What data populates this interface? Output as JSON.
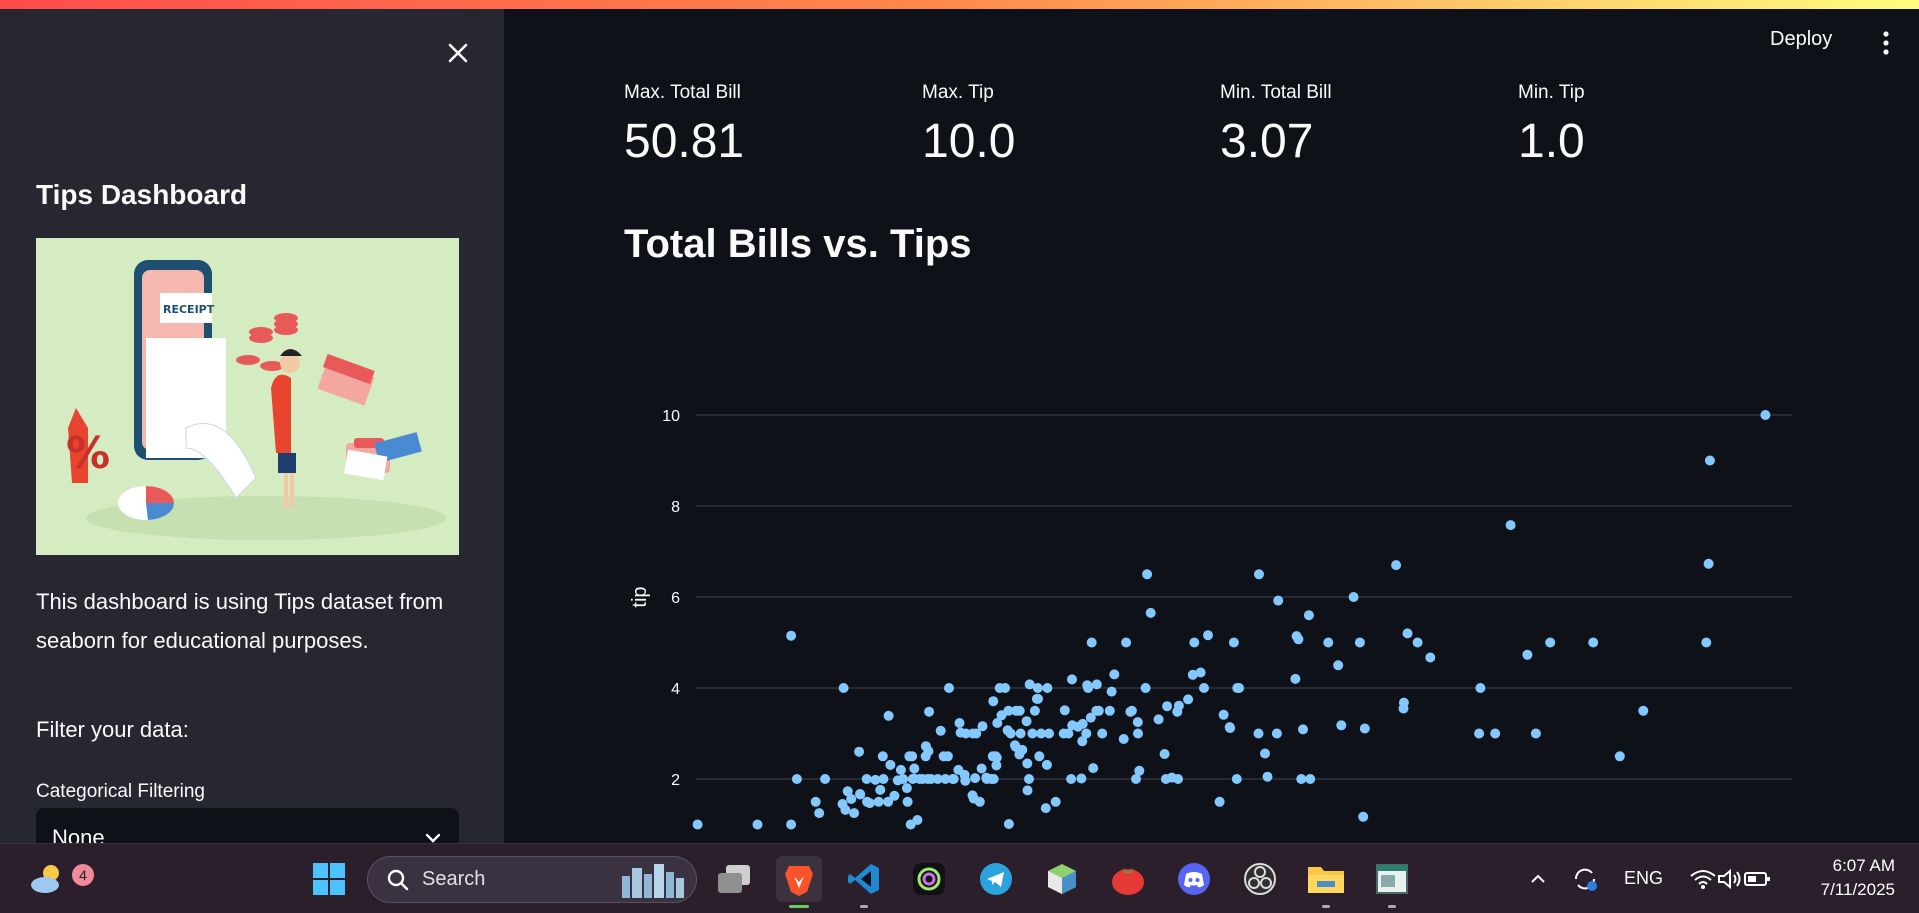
{
  "header": {
    "deploy_label": "Deploy"
  },
  "sidebar": {
    "title": "Tips Dashboard",
    "description": "This dashboard is using Tips dataset from seaborn for educational purposes.",
    "filter_heading": "Filter your data:",
    "categorical_label": "Categorical Filtering",
    "categorical_value": "None",
    "image_text": "RECEIPT"
  },
  "metrics": [
    {
      "label": "Max. Total Bill",
      "value": "50.81"
    },
    {
      "label": "Max. Tip",
      "value": "10.0"
    },
    {
      "label": "Min. Total Bill",
      "value": "3.07"
    },
    {
      "label": "Min. Tip",
      "value": "1.0"
    }
  ],
  "main": {
    "chart_title": "Total Bills vs. Tips"
  },
  "chart_data": {
    "type": "scatter",
    "title": "Total Bills vs. Tips",
    "xlabel": "",
    "ylabel": "tip",
    "ylim": [
      0.5,
      10.5
    ],
    "xlim": [
      3,
      52
    ],
    "yticks": [
      2,
      4,
      6,
      8,
      10
    ],
    "grid": true,
    "color": "#83c9ff",
    "points": [
      [
        3.07,
        1.0
      ],
      [
        5.75,
        1.0
      ],
      [
        7.25,
        1.0
      ],
      [
        7.25,
        5.15
      ],
      [
        7.51,
        2.0
      ],
      [
        8.35,
        1.5
      ],
      [
        8.51,
        1.25
      ],
      [
        8.77,
        2.0
      ],
      [
        9.55,
        1.45
      ],
      [
        9.6,
        4.0
      ],
      [
        9.68,
        1.32
      ],
      [
        9.78,
        1.73
      ],
      [
        9.94,
        1.56
      ],
      [
        10.07,
        1.25
      ],
      [
        10.29,
        2.6
      ],
      [
        10.33,
        1.67
      ],
      [
        10.34,
        1.66
      ],
      [
        10.63,
        2.0
      ],
      [
        10.65,
        1.5
      ],
      [
        10.77,
        1.47
      ],
      [
        11.02,
        1.98
      ],
      [
        11.17,
        1.5
      ],
      [
        11.24,
        1.76
      ],
      [
        11.35,
        2.5
      ],
      [
        11.38,
        2.0
      ],
      [
        11.59,
        1.5
      ],
      [
        11.61,
        3.39
      ],
      [
        11.69,
        2.31
      ],
      [
        11.87,
        1.63
      ],
      [
        12.02,
        1.97
      ],
      [
        12.16,
        2.2
      ],
      [
        12.26,
        2.0
      ],
      [
        12.43,
        1.8
      ],
      [
        12.46,
        1.5
      ],
      [
        12.54,
        2.5
      ],
      [
        12.6,
        1.0
      ],
      [
        12.66,
        2.5
      ],
      [
        12.69,
        2.0
      ],
      [
        12.74,
        2.01
      ],
      [
        12.76,
        2.23
      ],
      [
        12.9,
        1.1
      ],
      [
        13.0,
        2.0
      ],
      [
        13.13,
        2.0
      ],
      [
        13.27,
        2.5
      ],
      [
        13.28,
        2.72
      ],
      [
        13.37,
        2.0
      ],
      [
        13.39,
        2.61
      ],
      [
        13.42,
        3.48
      ],
      [
        13.51,
        2.0
      ],
      [
        13.81,
        2.0
      ],
      [
        13.94,
        3.06
      ],
      [
        14.07,
        2.5
      ],
      [
        14.15,
        2.0
      ],
      [
        14.26,
        2.5
      ],
      [
        14.31,
        4.0
      ],
      [
        14.48,
        2.0
      ],
      [
        14.52,
        2.0
      ],
      [
        14.73,
        2.2
      ],
      [
        14.78,
        3.23
      ],
      [
        14.83,
        3.02
      ],
      [
        15.01,
        2.09
      ],
      [
        15.04,
        1.96
      ],
      [
        15.06,
        3.0
      ],
      [
        15.36,
        1.64
      ],
      [
        15.38,
        3.0
      ],
      [
        15.42,
        1.57
      ],
      [
        15.48,
        2.02
      ],
      [
        15.53,
        3.0
      ],
      [
        15.69,
        1.5
      ],
      [
        15.77,
        2.23
      ],
      [
        15.81,
        3.16
      ],
      [
        15.98,
        2.03
      ],
      [
        16.0,
        2.0
      ],
      [
        16.21,
        2.0
      ],
      [
        16.27,
        2.5
      ],
      [
        16.29,
        3.71
      ],
      [
        16.31,
        2.0
      ],
      [
        16.4,
        2.5
      ],
      [
        16.43,
        2.3
      ],
      [
        16.45,
        2.47
      ],
      [
        16.47,
        3.23
      ],
      [
        16.58,
        4.0
      ],
      [
        16.66,
        3.4
      ],
      [
        16.82,
        4.0
      ],
      [
        16.93,
        3.07
      ],
      [
        16.97,
        3.5
      ],
      [
        16.99,
        1.01
      ],
      [
        17.07,
        3.0
      ],
      [
        17.26,
        2.74
      ],
      [
        17.29,
        2.71
      ],
      [
        17.31,
        3.5
      ],
      [
        17.46,
        2.54
      ],
      [
        17.47,
        3.5
      ],
      [
        17.51,
        3.0
      ],
      [
        17.59,
        2.64
      ],
      [
        17.78,
        3.27
      ],
      [
        17.81,
        2.34
      ],
      [
        17.82,
        1.75
      ],
      [
        17.89,
        2.0
      ],
      [
        17.92,
        4.08
      ],
      [
        18.04,
        3.0
      ],
      [
        18.15,
        3.5
      ],
      [
        18.24,
        3.76
      ],
      [
        18.28,
        4.0
      ],
      [
        18.29,
        3.76
      ],
      [
        18.35,
        2.5
      ],
      [
        18.43,
        3.0
      ],
      [
        18.64,
        1.36
      ],
      [
        18.69,
        2.31
      ],
      [
        18.71,
        4.0
      ],
      [
        18.78,
        3.0
      ],
      [
        19.08,
        1.5
      ],
      [
        19.44,
        3.0
      ],
      [
        19.49,
        3.51
      ],
      [
        19.65,
        3.0
      ],
      [
        19.77,
        2.0
      ],
      [
        19.81,
        4.19
      ],
      [
        19.82,
        3.18
      ],
      [
        20.08,
        3.15
      ],
      [
        20.23,
        2.01
      ],
      [
        20.27,
        2.83
      ],
      [
        20.29,
        3.21
      ],
      [
        20.45,
        3.0
      ],
      [
        20.49,
        4.06
      ],
      [
        20.53,
        4.0
      ],
      [
        20.65,
        3.35
      ],
      [
        20.69,
        5.0
      ],
      [
        20.76,
        2.24
      ],
      [
        20.9,
        3.5
      ],
      [
        20.92,
        4.08
      ],
      [
        21.01,
        3.5
      ],
      [
        21.16,
        3.0
      ],
      [
        21.5,
        3.5
      ],
      [
        21.58,
        3.92
      ],
      [
        21.7,
        4.3
      ],
      [
        22.12,
        2.88
      ],
      [
        22.23,
        5.0
      ],
      [
        22.42,
        3.48
      ],
      [
        22.49,
        3.5
      ],
      [
        22.67,
        2.0
      ],
      [
        22.75,
        3.25
      ],
      [
        22.76,
        3.0
      ],
      [
        22.82,
        2.18
      ],
      [
        23.1,
        4.0
      ],
      [
        23.17,
        6.5
      ],
      [
        23.33,
        5.65
      ],
      [
        23.68,
        3.31
      ],
      [
        23.95,
        2.55
      ],
      [
        24.01,
        2.0
      ],
      [
        24.06,
        3.6
      ],
      [
        24.27,
        2.03
      ],
      [
        24.52,
        3.48
      ],
      [
        24.55,
        2.0
      ],
      [
        24.59,
        3.61
      ],
      [
        25.0,
        3.75
      ],
      [
        25.21,
        4.29
      ],
      [
        25.28,
        5.0
      ],
      [
        25.56,
        4.34
      ],
      [
        25.71,
        4.0
      ],
      [
        25.89,
        5.16
      ],
      [
        26.41,
        1.5
      ],
      [
        26.59,
        3.41
      ],
      [
        26.86,
        3.14
      ],
      [
        26.88,
        3.12
      ],
      [
        27.05,
        5.0
      ],
      [
        27.2,
        4.0
      ],
      [
        27.28,
        4.0
      ],
      [
        27.18,
        2.0
      ],
      [
        28.15,
        3.0
      ],
      [
        28.17,
        6.5
      ],
      [
        28.44,
        2.56
      ],
      [
        28.55,
        2.05
      ],
      [
        28.97,
        3.0
      ],
      [
        29.03,
        5.92
      ],
      [
        29.8,
        4.2
      ],
      [
        29.85,
        5.14
      ],
      [
        29.93,
        5.07
      ],
      [
        30.06,
        2.0
      ],
      [
        30.14,
        3.09
      ],
      [
        30.4,
        5.6
      ],
      [
        30.46,
        2.0
      ],
      [
        31.27,
        5.0
      ],
      [
        31.71,
        4.5
      ],
      [
        31.85,
        3.18
      ],
      [
        32.4,
        6.0
      ],
      [
        32.68,
        5.0
      ],
      [
        32.83,
        1.17
      ],
      [
        32.9,
        3.11
      ],
      [
        34.3,
        6.7
      ],
      [
        34.63,
        3.55
      ],
      [
        34.65,
        3.68
      ],
      [
        34.81,
        5.2
      ],
      [
        35.26,
        5.0
      ],
      [
        35.83,
        4.67
      ],
      [
        38.01,
        3.0
      ],
      [
        38.07,
        4.0
      ],
      [
        38.73,
        3.0
      ],
      [
        39.42,
        7.58
      ],
      [
        40.17,
        4.73
      ],
      [
        40.55,
        3.0
      ],
      [
        41.19,
        5.0
      ],
      [
        43.11,
        5.0
      ],
      [
        44.3,
        2.5
      ],
      [
        45.35,
        3.5
      ],
      [
        48.17,
        5.0
      ],
      [
        48.27,
        6.73
      ],
      [
        48.33,
        9.0
      ],
      [
        50.81,
        10.0
      ]
    ]
  },
  "taskbar": {
    "weather_badge": "4",
    "search_label": "Search",
    "lang": "ENG",
    "time": "6:07 AM",
    "date": "7/11/2025"
  }
}
